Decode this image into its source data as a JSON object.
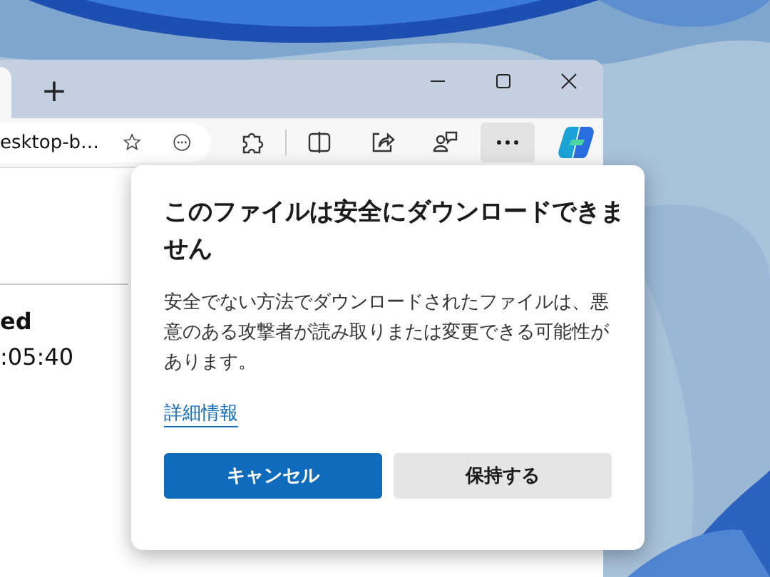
{
  "browser": {
    "new_tab_button": "+",
    "address_bar": {
      "value": "esktop-b…"
    },
    "menu_open": true
  },
  "page": {
    "lines": [
      {
        "text": "ed",
        "bold": true
      },
      {
        "text": ":05:40",
        "bold": false
      }
    ]
  },
  "dialog": {
    "title": "このファイルは安全にダウンロードできません",
    "message": "安全でない方法でダウンロードされたファイルは、悪意のある攻撃者が読み取りまたは変更できる可能性があります。",
    "link": "詳細情報",
    "buttons": [
      {
        "label": "キャンセル",
        "kind": "primary"
      },
      {
        "label": "保持する",
        "kind": "secondary"
      }
    ]
  }
}
